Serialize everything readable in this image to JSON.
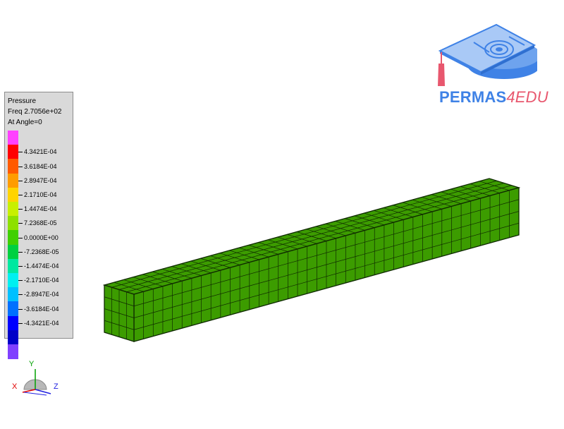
{
  "legend": {
    "title": "Pressure",
    "subtitle": "Freq 2.7056e+02",
    "angle": "At Angle=0",
    "colors": [
      "#ff40ff",
      "#ff0000",
      "#ff5a00",
      "#ff9c00",
      "#ffd400",
      "#c8f000",
      "#8ee000",
      "#40d000",
      "#00d040",
      "#00e8a0",
      "#00f0f0",
      "#00c0ff",
      "#0070ff",
      "#0000ff",
      "#0000c8",
      "#8040ff"
    ],
    "labels": [
      "4.3421E-04",
      "3.6184E-04",
      "2.8947E-04",
      "2.1710E-04",
      "1.4474E-04",
      "7.2368E-05",
      "0.0000E+00",
      "-7.2368E-05",
      "-1.4474E-04",
      "-2.1710E-04",
      "-2.8947E-04",
      "-3.6184E-04",
      "-4.3421E-04"
    ]
  },
  "logo": {
    "brand": "PERMAS",
    "suffix": "4EDU"
  },
  "triad": {
    "x": "X",
    "y": "Y",
    "z": "Z"
  },
  "model": {
    "color": "#3c9c00",
    "grid_color": "#0f2a00"
  }
}
